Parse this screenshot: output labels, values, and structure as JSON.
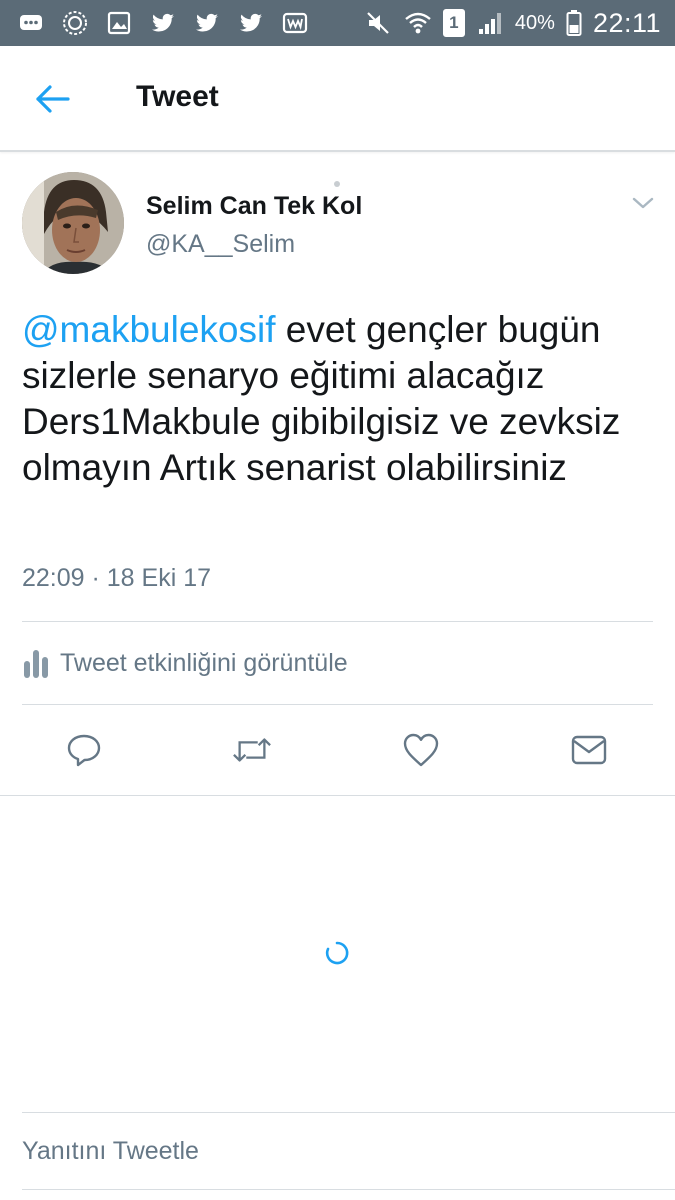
{
  "status_bar": {
    "battery": "40%",
    "sim": "1",
    "time": "22:11",
    "icons": [
      "chat-icon",
      "sync-icon",
      "gallery-icon",
      "twitter-icon",
      "twitter-icon",
      "twitter-icon",
      "wordpress-icon",
      "mute-icon",
      "wifi-icon",
      "sim-icon",
      "signal-icon",
      "battery-icon"
    ]
  },
  "header": {
    "title": "Tweet",
    "back_icon": "arrow-left-icon"
  },
  "tweet": {
    "author_name": "Selim Can Tek Kol",
    "author_handle": "@KA__Selim",
    "mention": "@makbulekosif",
    "text_rest": " evet gençler bugün sizlerle senaryo eğitimi alacağız Ders1Makbule gibibilgisiz ve zevksiz olmayın Artık senarist olabilirsiniz",
    "timestamp": "22:09 · 18 Eki 17"
  },
  "activity": {
    "label": "Tweet etkinliğini görüntüle"
  },
  "actions": [
    "reply-icon",
    "retweet-icon",
    "like-icon",
    "share-dm-icon"
  ],
  "reply": {
    "placeholder": "Yanıtını Tweetle"
  },
  "colors": {
    "status_bar": "#5b6b77",
    "accent": "#1da1f2",
    "secondary_text": "#657786",
    "primary_text": "#14171a"
  }
}
